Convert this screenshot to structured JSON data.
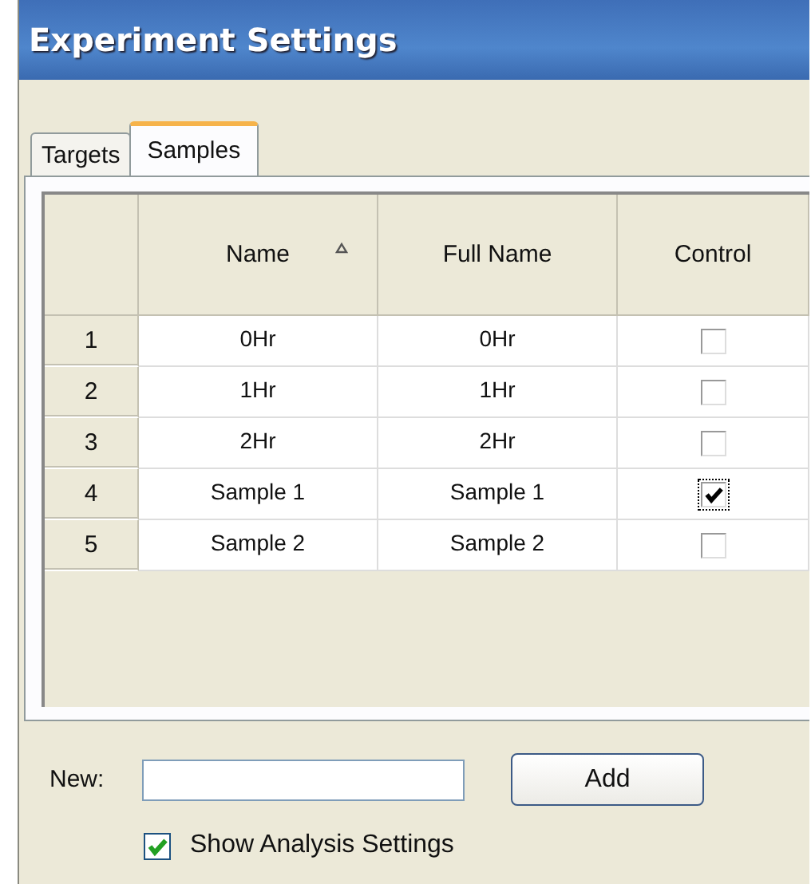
{
  "window": {
    "title": "Experiment Settings"
  },
  "tabs": [
    {
      "label": "Targets",
      "selected": false
    },
    {
      "label": "Samples",
      "selected": true
    }
  ],
  "table": {
    "columns": [
      {
        "sorted": false
      },
      {
        "label": "Name",
        "sorted": true
      },
      {
        "label": "Full Name",
        "sorted": false
      },
      {
        "label": "Control",
        "sorted": false
      }
    ],
    "rows": [
      {
        "index": "1",
        "name": "0Hr",
        "full_name": "0Hr",
        "control": false,
        "focused": false
      },
      {
        "index": "2",
        "name": "1Hr",
        "full_name": "1Hr",
        "control": false,
        "focused": false
      },
      {
        "index": "3",
        "name": "2Hr",
        "full_name": "2Hr",
        "control": false,
        "focused": false
      },
      {
        "index": "4",
        "name": "Sample 1",
        "full_name": "Sample 1",
        "control": true,
        "focused": true
      },
      {
        "index": "5",
        "name": "Sample 2",
        "full_name": "Sample 2",
        "control": false,
        "focused": false
      }
    ]
  },
  "new_field": {
    "label": "New:"
  },
  "add_button": {
    "label": "Add"
  },
  "show_analysis": {
    "label": "Show Analysis Settings",
    "checked": true
  }
}
